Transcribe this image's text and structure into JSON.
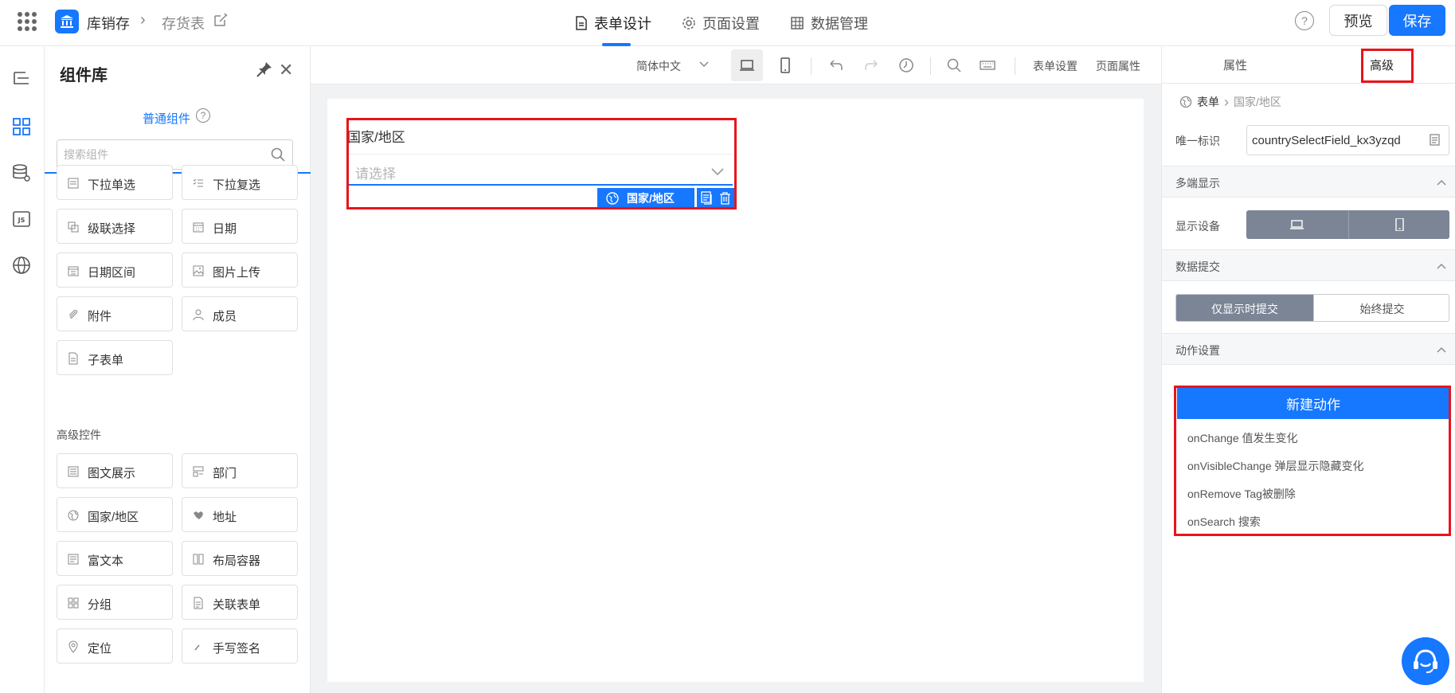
{
  "header": {
    "app_name": "库销存",
    "page_name": "存货表",
    "tabs": [
      {
        "label": "表单设计",
        "icon": "document-icon",
        "active": true
      },
      {
        "label": "页面设置",
        "icon": "gear-icon",
        "active": false
      },
      {
        "label": "数据管理",
        "icon": "table-icon",
        "active": false
      }
    ],
    "help_symbol": "?",
    "preview_label": "预览",
    "save_label": "保存"
  },
  "library": {
    "title": "组件库",
    "tab_label": "普通组件",
    "search_placeholder": "搜索组件",
    "basic": [
      {
        "label": "下拉单选",
        "icon": "select-icon"
      },
      {
        "label": "下拉复选",
        "icon": "multiselect-icon"
      },
      {
        "label": "级联选择",
        "icon": "cascade-icon"
      },
      {
        "label": "日期",
        "icon": "calendar-icon"
      },
      {
        "label": "日期区间",
        "icon": "date-range-icon"
      },
      {
        "label": "图片上传",
        "icon": "image-icon"
      },
      {
        "label": "附件",
        "icon": "paperclip-icon"
      },
      {
        "label": "成员",
        "icon": "user-icon"
      },
      {
        "label": "子表单",
        "icon": "subform-icon"
      }
    ],
    "advanced_title": "高级控件",
    "advanced": [
      {
        "label": "图文展示",
        "icon": "richtext-display-icon"
      },
      {
        "label": "部门",
        "icon": "department-icon"
      },
      {
        "label": "国家/地区",
        "icon": "globe-icon"
      },
      {
        "label": "地址",
        "icon": "map-icon"
      },
      {
        "label": "富文本",
        "icon": "richtext-icon"
      },
      {
        "label": "布局容器",
        "icon": "layout-icon"
      },
      {
        "label": "分组",
        "icon": "group-icon"
      },
      {
        "label": "关联表单",
        "icon": "linked-form-icon"
      },
      {
        "label": "定位",
        "icon": "location-icon"
      },
      {
        "label": "手写签名",
        "icon": "signature-icon"
      }
    ]
  },
  "toolbar": {
    "language": "简体中文",
    "form_settings": "表单设置",
    "page_properties": "页面属性"
  },
  "canvas": {
    "field_label": "国家/地区",
    "placeholder": "请选择",
    "tag_label": "国家/地区"
  },
  "props": {
    "tab_attributes": "属性",
    "tab_advanced": "高级",
    "breadcrumb_root": "表单",
    "breadcrumb_current": "国家/地区",
    "uid_label": "唯一标识",
    "uid_value": "countrySelectField_kx3yzqd",
    "section_multi": "多端显示",
    "device_label": "显示设备",
    "section_submit": "数据提交",
    "submit_on": "仅显示时提交",
    "submit_always": "始终提交",
    "section_action": "动作设置",
    "new_action": "新建动作",
    "events": [
      "onChange 值发生变化",
      "onVisibleChange 弹层显示隐藏变化",
      "onRemove Tag被删除",
      "onSearch 搜索"
    ]
  },
  "colors": {
    "primary": "#1677ff",
    "highlight": "#e8141b",
    "segment_active": "#7b8595"
  }
}
